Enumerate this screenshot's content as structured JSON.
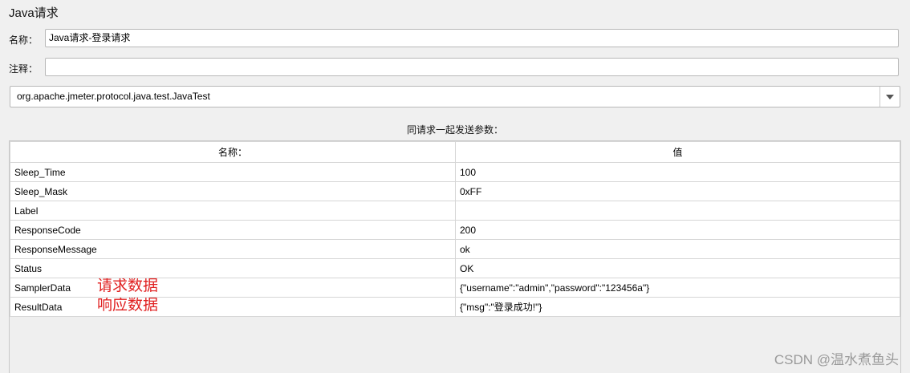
{
  "panel": {
    "title": "Java请求"
  },
  "name_field": {
    "label": "名称：",
    "value": "Java请求-登录请求"
  },
  "comment_field": {
    "label": "注释：",
    "value": ""
  },
  "classname_select": {
    "selected": "org.apache.jmeter.protocol.java.test.JavaTest"
  },
  "params": {
    "caption": "同请求一起发送参数：",
    "headers": [
      "名称：",
      "值"
    ],
    "rows": [
      {
        "name": "Sleep_Time",
        "value": "100",
        "note": ""
      },
      {
        "name": "Sleep_Mask",
        "value": "0xFF",
        "note": ""
      },
      {
        "name": "Label",
        "value": "",
        "note": ""
      },
      {
        "name": "ResponseCode",
        "value": "200",
        "note": ""
      },
      {
        "name": "ResponseMessage",
        "value": "ok",
        "note": ""
      },
      {
        "name": "Status",
        "value": "OK",
        "note": ""
      },
      {
        "name": "SamplerData",
        "value": "{\"username\":\"admin\",\"password\":\"123456a\"}",
        "note": "请求数据"
      },
      {
        "name": "ResultData",
        "value": "{\"msg\":\"登录成功!\"}",
        "note": "响应数据"
      }
    ]
  },
  "watermark": "CSDN @温水煮鱼头",
  "colors": {
    "annotation": "#e02020",
    "background": "#f0f0f0"
  }
}
